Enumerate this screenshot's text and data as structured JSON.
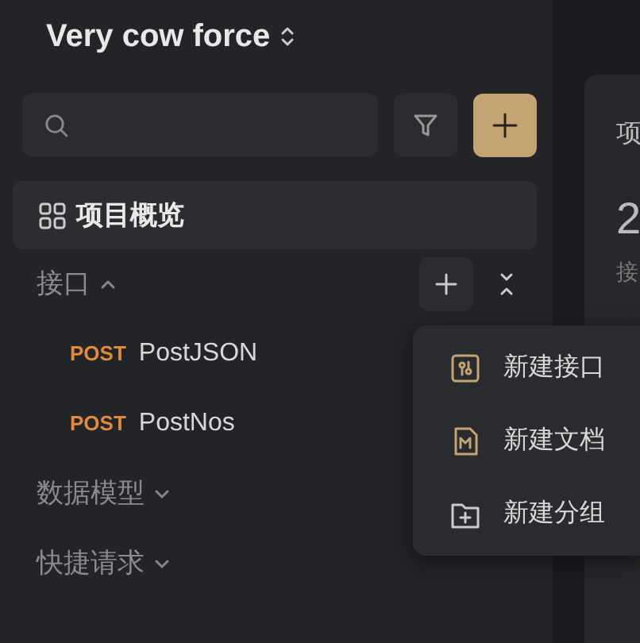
{
  "project": {
    "title": "Very cow force"
  },
  "nav": {
    "overview": "项目概览"
  },
  "sections": [
    {
      "label": "接口",
      "expanded": true,
      "has_actions": true,
      "items": [
        {
          "method": "POST",
          "name": "PostJSON"
        },
        {
          "method": "POST",
          "name": "PostNos"
        }
      ]
    },
    {
      "label": "数据模型",
      "expanded": false,
      "has_actions": false
    },
    {
      "label": "快捷请求",
      "expanded": false,
      "has_actions": false
    }
  ],
  "menu": [
    {
      "label": "新建接口",
      "kind": "api"
    },
    {
      "label": "新建文档",
      "kind": "doc"
    },
    {
      "label": "新建分组",
      "kind": "folder"
    }
  ],
  "right_panel": {
    "card_title": "项",
    "value": "2",
    "caption": "接"
  }
}
